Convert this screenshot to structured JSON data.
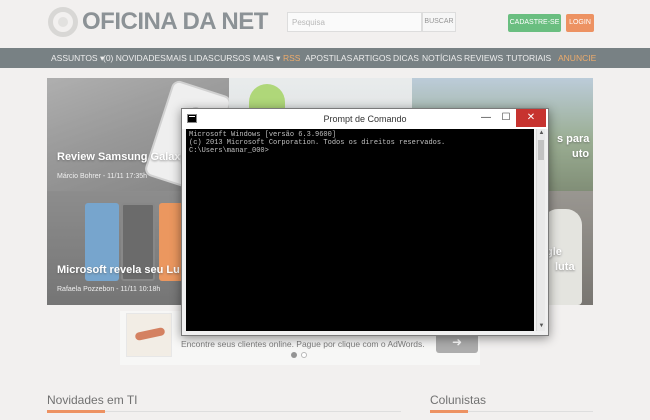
{
  "site": {
    "logo": "OFICINA DA NET",
    "search_placeholder": "Pesquisa",
    "search_button": "BUSCAR",
    "signup_button": "CADASTRE-SE",
    "login_button": "LOGIN"
  },
  "nav": {
    "items": [
      "ASSUNTOS",
      "(0) NOVIDADES",
      "MAIS LIDAS",
      "CURSOS",
      "MAIS",
      "RSS",
      "APOSTILAS",
      "ARTIGOS",
      "DICAS",
      "NOTÍCIAS",
      "REVIEWS",
      "TUTORIAIS",
      "ANUNCIE"
    ],
    "assuntos_caret": "▾",
    "mais_caret": "▾"
  },
  "featured": [
    {
      "title": "Review Samsung Galaxy",
      "author_date": "Márcio Bohrer - 11/11 17:35h"
    },
    {
      "title": "Microsoft revela seu Lu",
      "author_date": "Rafaela Pozzebon - 11/11 10:18h"
    },
    {
      "title_fragment_1": "s para",
      "title_fragment_2": "uto"
    },
    {
      "title_fragment_1": "gle",
      "title_fragment_2": "luta"
    }
  ],
  "ad": {
    "text": "Encontre seus clientes online. Pague por clique com o AdWords.",
    "arrow": "➜"
  },
  "sections": {
    "left": "Novidades em TI",
    "right": "Colunistas"
  },
  "cmd": {
    "title": "Prompt de Comando",
    "minimize": "—",
    "maximize": "☐",
    "close": "✕",
    "lines": [
      "Microsoft Windows [versão 6.3.9600]",
      "(c) 2013 Microsoft Corporation. Todos os direitos reservados.",
      "",
      "C:\\Users\\manar_000>"
    ],
    "scroll_up": "▲",
    "scroll_down": "▼"
  },
  "colors": {
    "nav_bg": "#3e4b50",
    "accent_orange": "#e5631f",
    "signup_green": "#2aa349",
    "close_red": "#c7332f"
  }
}
